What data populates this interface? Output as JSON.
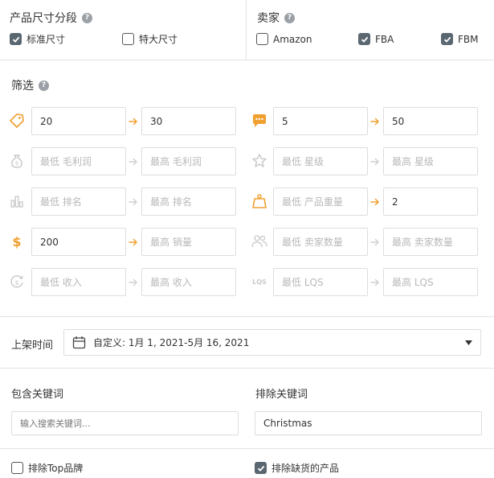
{
  "size_segment": {
    "title": "产品尺寸分段",
    "options": [
      {
        "label": "标准尺寸",
        "checked": true
      },
      {
        "label": "特大尺寸",
        "checked": false
      }
    ]
  },
  "seller": {
    "title": "卖家",
    "options": [
      {
        "label": "Amazon",
        "checked": false
      },
      {
        "label": "FBA",
        "checked": true
      },
      {
        "label": "FBM",
        "checked": true
      }
    ]
  },
  "filters": {
    "title": "筛选",
    "rows": [
      {
        "left_icon": "price-tag-icon",
        "left_min": "20",
        "left_max": "30",
        "left_active": true,
        "right_icon": "reviews-icon",
        "right_min": "5",
        "right_max": "50",
        "right_active": true
      },
      {
        "left_icon": "money-bag-icon",
        "left_min": "最低 毛利润",
        "left_max": "最高 毛利润",
        "left_active": false,
        "right_icon": "star-icon",
        "right_min": "最低 星级",
        "right_max": "最高 星级",
        "right_active": false
      },
      {
        "left_icon": "bar-chart-icon",
        "left_min": "最低 排名",
        "left_max": "最高 排名",
        "left_active": false,
        "right_icon": "weight-icon",
        "right_min": "最低 产品重量",
        "right_max": "2",
        "right_active": true
      },
      {
        "left_icon": "dollar-icon",
        "left_min": "200",
        "left_max": "最高 销量",
        "left_active": true,
        "right_icon": "sellers-icon",
        "right_min": "最低 卖家数量",
        "right_max": "最高 卖家数量",
        "right_active": false
      },
      {
        "left_icon": "revenue-icon",
        "left_min": "最低 收入",
        "left_max": "最高 收入",
        "left_active": false,
        "right_icon": "lqs-icon",
        "right_min": "最低 LQS",
        "right_max": "最高 LQS",
        "right_active": false
      }
    ]
  },
  "listing_time": {
    "label": "上架时间",
    "value": "自定义: 1月 1, 2021-5月 16, 2021"
  },
  "keywords": {
    "include_label": "包含关键词",
    "include_placeholder": "输入搜索关键词...",
    "include_value": "",
    "exclude_label": "排除关键词",
    "exclude_value": "Christmas"
  },
  "bottom_options": [
    {
      "label": "排除Top品牌",
      "checked": false
    },
    {
      "label": "排除缺货的产品",
      "checked": true
    }
  ],
  "colors": {
    "accent": "#f0a030",
    "muted_icon": "#c8c8c8",
    "border": "#dddddd",
    "checkbox_on": "#5b6770"
  }
}
